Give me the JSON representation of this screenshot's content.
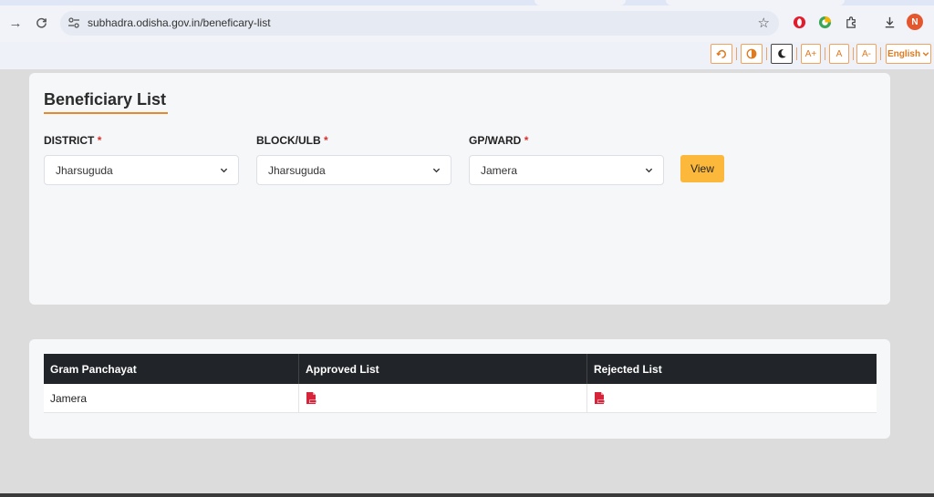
{
  "browser": {
    "url": "subhadra.odisha.gov.in/beneficary-list",
    "avatar_initial": "N"
  },
  "accessibility": {
    "font_increase": "A+",
    "font_normal": "A",
    "font_decrease": "A-",
    "language": "English"
  },
  "filter": {
    "title": "Beneficiary List",
    "district_label": "DISTRICT",
    "district_value": "Jharsuguda",
    "block_label": "BLOCK/ULB",
    "block_value": "Jharsuguda",
    "gp_label": "GP/WARD",
    "gp_value": "Jamera",
    "required_mark": "*",
    "view_label": "View"
  },
  "table": {
    "headers": [
      "Gram Panchayat",
      "Approved List",
      "Rejected List"
    ],
    "rows": [
      {
        "gram_panchayat": "Jamera"
      }
    ]
  },
  "colors": {
    "accent_orange": "#e5892f",
    "view_button": "#fbb83b",
    "table_header": "#212529",
    "pdf_red": "#d6243b"
  }
}
